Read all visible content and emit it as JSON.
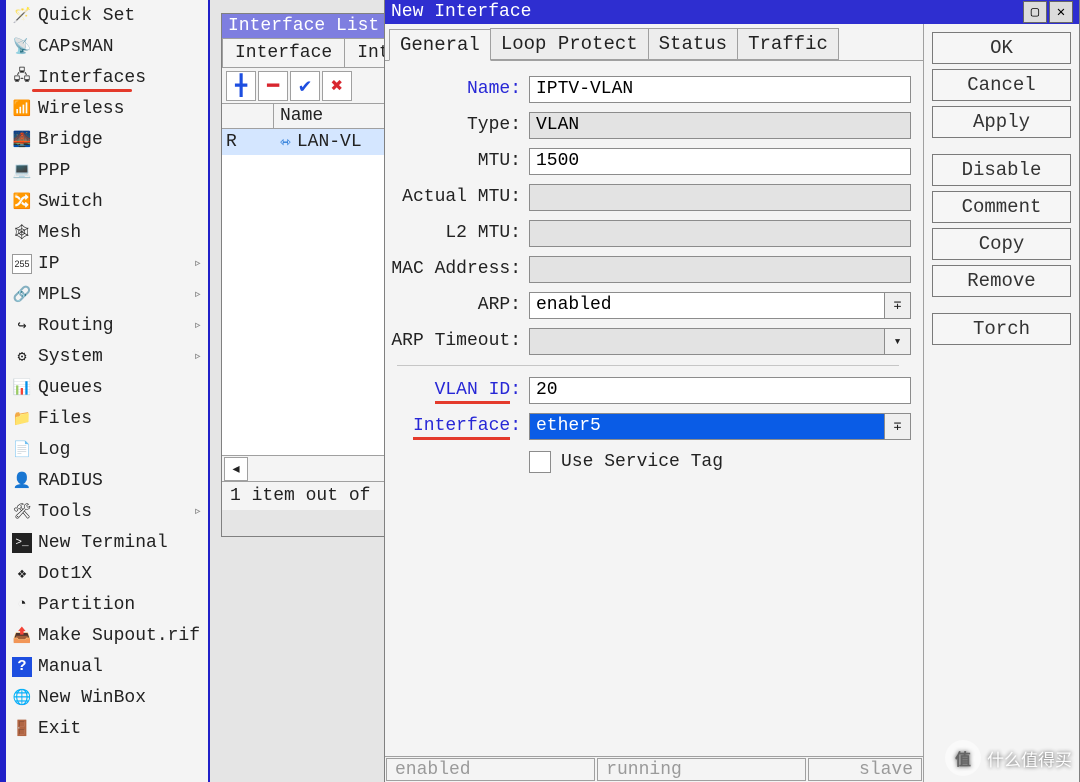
{
  "sidebar": {
    "items": [
      {
        "label": "Quick Set",
        "icon": "🪄",
        "sub": false,
        "ul": false
      },
      {
        "label": "CAPsMAN",
        "icon": "📡",
        "sub": false,
        "ul": false
      },
      {
        "label": "Interfaces",
        "icon": "🖧",
        "sub": false,
        "ul": true
      },
      {
        "label": "Wireless",
        "icon": "📶",
        "sub": false,
        "ul": false
      },
      {
        "label": "Bridge",
        "icon": "🌉",
        "sub": false,
        "ul": false
      },
      {
        "label": "PPP",
        "icon": "💻",
        "sub": false,
        "ul": false
      },
      {
        "label": "Switch",
        "icon": "🔀",
        "sub": false,
        "ul": false
      },
      {
        "label": "Mesh",
        "icon": "🕸",
        "sub": false,
        "ul": false
      },
      {
        "label": "IP",
        "icon": "255",
        "sub": true,
        "ul": false
      },
      {
        "label": "MPLS",
        "icon": "🔗",
        "sub": true,
        "ul": false
      },
      {
        "label": "Routing",
        "icon": "↪",
        "sub": true,
        "ul": false
      },
      {
        "label": "System",
        "icon": "⚙",
        "sub": true,
        "ul": false
      },
      {
        "label": "Queues",
        "icon": "📊",
        "sub": false,
        "ul": false
      },
      {
        "label": "Files",
        "icon": "📁",
        "sub": false,
        "ul": false
      },
      {
        "label": "Log",
        "icon": "📄",
        "sub": false,
        "ul": false
      },
      {
        "label": "RADIUS",
        "icon": "👤",
        "sub": false,
        "ul": false
      },
      {
        "label": "Tools",
        "icon": "🛠",
        "sub": true,
        "ul": false
      },
      {
        "label": "New Terminal",
        "icon": ">_",
        "sub": false,
        "ul": false
      },
      {
        "label": "Dot1X",
        "icon": "❖",
        "sub": false,
        "ul": false
      },
      {
        "label": "Partition",
        "icon": "◔",
        "sub": false,
        "ul": false
      },
      {
        "label": "Make Supout.rif",
        "icon": "📤",
        "sub": false,
        "ul": false
      },
      {
        "label": "Manual",
        "icon": "?",
        "sub": false,
        "ul": false
      },
      {
        "label": "New WinBox",
        "icon": "🌐",
        "sub": false,
        "ul": false
      },
      {
        "label": "Exit",
        "icon": "🚪",
        "sub": false,
        "ul": false
      }
    ]
  },
  "iflist": {
    "title": "Interface List",
    "tabs": [
      "Interface",
      "Inte"
    ],
    "columns": {
      "flag": "",
      "name": "Name"
    },
    "row": {
      "flag": "R",
      "icon": "⇿",
      "name": "LAN-VL"
    },
    "status": "1 item out of "
  },
  "newif": {
    "title": "New Interface",
    "tabs": [
      "General",
      "Loop Protect",
      "Status",
      "Traffic"
    ],
    "labels": {
      "name": "Name:",
      "type": "Type:",
      "mtu": "MTU:",
      "amtu": "Actual MTU:",
      "l2mtu": "L2 MTU:",
      "mac": "MAC Address:",
      "arp": "ARP:",
      "arpto": "ARP Timeout:",
      "vlanid": "VLAN ID",
      "interface": "Interface",
      "usetag": "Use Service Tag"
    },
    "values": {
      "name": "IPTV-VLAN",
      "type": "VLAN",
      "mtu": "1500",
      "amtu": "",
      "l2mtu": "",
      "mac": "",
      "arp": "enabled",
      "arpto": "",
      "vlanid": "20",
      "interface": "ether5"
    },
    "buttons": {
      "ok": "OK",
      "cancel": "Cancel",
      "apply": "Apply",
      "disable": "Disable",
      "comment": "Comment",
      "copy": "Copy",
      "remove": "Remove",
      "torch": "Torch"
    },
    "statusbar": [
      "enabled",
      "running",
      "slave"
    ]
  },
  "watermark": "什么值得买"
}
